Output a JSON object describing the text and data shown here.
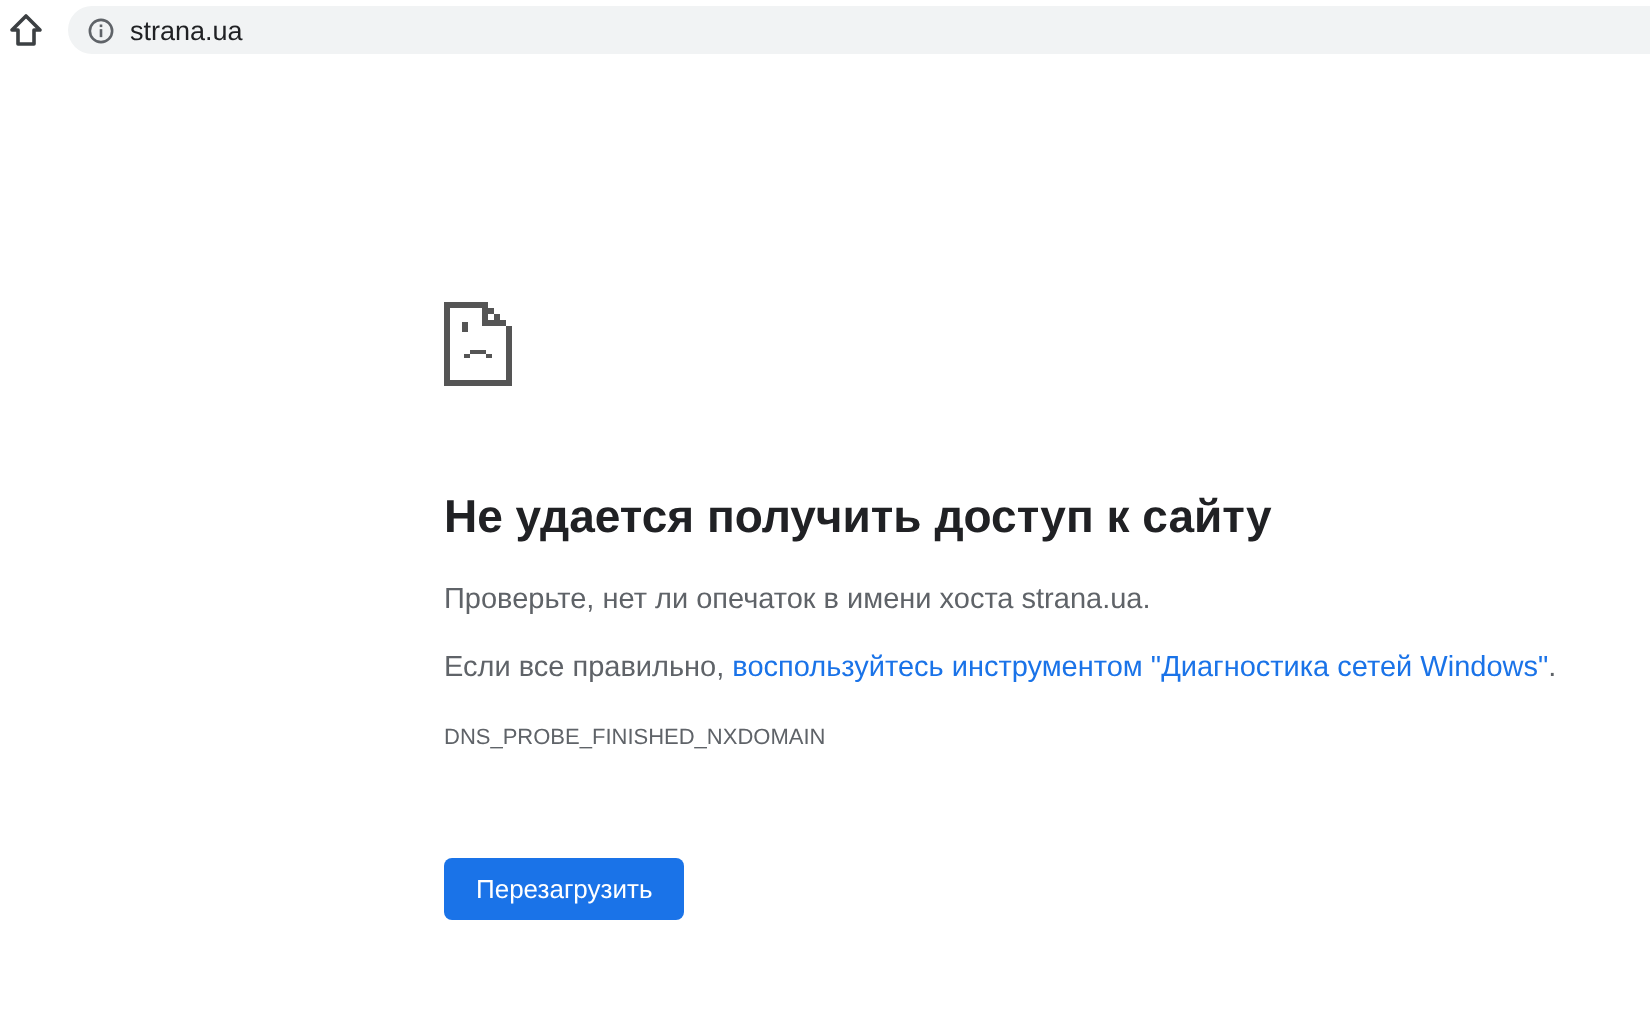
{
  "address_bar": {
    "url": "strana.ua"
  },
  "error": {
    "title": "Не удается получить доступ к сайту",
    "hint": "Проверьте, нет ли опечаток в имени хоста strana.ua.",
    "suggestion": {
      "before": "Если все правильно, ",
      "link": "воспользуйтесь инструментом \"Диагностика сетей Windows\"",
      "after": "."
    },
    "code": "DNS_PROBE_FINISHED_NXDOMAIN",
    "button": "Перезагрузить"
  }
}
